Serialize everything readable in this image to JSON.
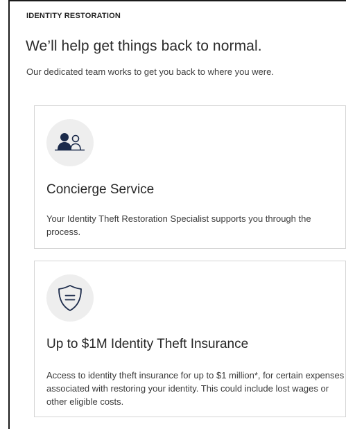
{
  "section": {
    "eyebrow": "IDENTITY RESTORATION",
    "headline": "We’ll help get things back to normal.",
    "intro": "Our dedicated team works to get you back to where you were."
  },
  "cards": [
    {
      "icon": "concierge-people-icon",
      "title": "Concierge Service",
      "body": "Your Identity Theft Restoration Specialist supports you through the process."
    },
    {
      "icon": "shield-icon",
      "title": "Up to $1M Identity Theft Insurance",
      "body": "Access to identity theft insurance for up to $1 million*, for certain expenses associated with restoring your identity. This could include lost wages or other eligible costs."
    }
  ],
  "colors": {
    "accent_navy": "#1b2a4a",
    "marker_red": "#e0281e",
    "card_border": "#d4d4d4",
    "icon_bg": "#eeeeee"
  }
}
